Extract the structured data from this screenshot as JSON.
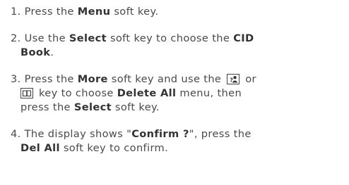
{
  "steps": [
    {
      "number": "1.",
      "segments": [
        {
          "t": " Press the "
        },
        {
          "b": "Menu"
        },
        {
          "t": " soft key."
        }
      ]
    },
    {
      "number": "2.",
      "line1": [
        {
          "t": " Use the "
        },
        {
          "b": "Select"
        },
        {
          "t": " soft key to choose the "
        },
        {
          "b": "CID"
        }
      ],
      "line2": [
        {
          "b": "Book"
        },
        {
          "t": "."
        }
      ]
    },
    {
      "number": "3.",
      "line1_a": " Press the ",
      "line1_b": "More",
      "line1_c": " soft key and use the ",
      "line1_d": " or",
      "line2_a": " key to choose ",
      "line2_b": "Delete All",
      "line2_c": " menu, then",
      "line3_a": "press the ",
      "line3_b": "Select",
      "line3_c": " soft key.",
      "icon1": "phonebook-person-key-icon",
      "icon2": "book-key-icon"
    },
    {
      "number": "4.",
      "line1_a": " The display shows \"",
      "line1_b": "Confirm ?",
      "line1_c": "\", press the",
      "line2_a": "Del All",
      "line2_b": " soft key to confirm."
    }
  ]
}
